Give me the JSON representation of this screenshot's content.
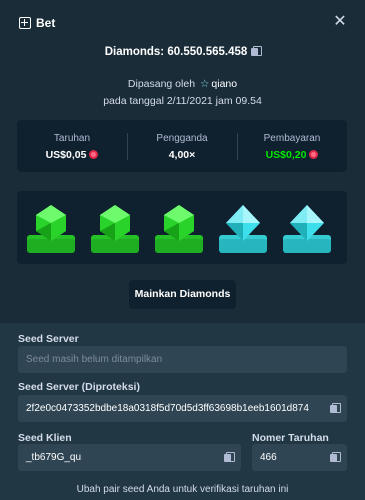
{
  "header": {
    "title": "Bet",
    "close_label": "✕"
  },
  "summary": {
    "diamonds_label": "Diamonds: 60.550.565.458",
    "placed_by_prefix": "Dipasang oleh",
    "user": "qiano",
    "placed_on": "pada tanggal 2/11/2021 jam 09.54"
  },
  "stats": {
    "bet": {
      "label": "Taruhan",
      "value": "US$0,05"
    },
    "multiplier": {
      "label": "Pengganda",
      "value": "4,00×"
    },
    "payout": {
      "label": "Pembayaran",
      "value": "US$0,20"
    }
  },
  "game": {
    "tiles": [
      "green",
      "green",
      "green",
      "blue",
      "blue"
    ],
    "colors": {
      "green": "#2ad32a",
      "blue": "#3de0ea"
    }
  },
  "actions": {
    "play_label": "Mainkan Diamonds"
  },
  "fairness": {
    "server_seed": {
      "label": "Seed Server",
      "placeholder": "Seed masih belum ditampilkan"
    },
    "hashed_seed": {
      "label": "Seed Server (Diproteksi)",
      "value": "2f2e0c0473352bdbe18a0318f5d70d5d3ff63698b1eeb1601d874"
    },
    "client_seed": {
      "label": "Seed Klien",
      "value": "_tb679G_qu"
    },
    "nonce": {
      "label": "Nomer Taruhan",
      "value": "466"
    },
    "footer_link": "Ubah pair seed Anda untuk verifikasi taruhan ini"
  },
  "accent": {
    "win": "#00e701",
    "panel": "#0f212e",
    "bg": "#1a2c38",
    "input": "#2f4553"
  }
}
